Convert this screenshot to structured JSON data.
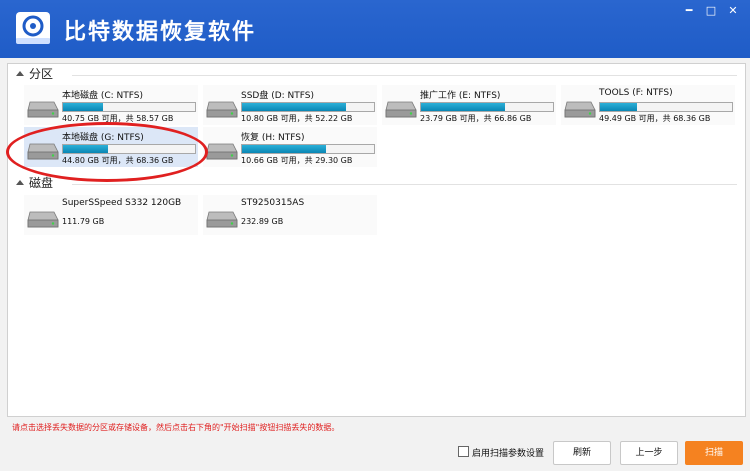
{
  "app": {
    "title": "比特数据恢复软件"
  },
  "window_controls": {
    "min": "━",
    "max": "□",
    "close": "✕"
  },
  "sections": {
    "partitions": "分区",
    "disks": "磁盘"
  },
  "partitions": [
    {
      "name": "本地磁盘 (C: NTFS)",
      "info": "40.75 GB 可用，共 58.57 GB",
      "used_fraction": 0.3
    },
    {
      "name": "SSD盘 (D: NTFS)",
      "info": "10.80 GB 可用，共 52.22 GB",
      "used_fraction": 0.79
    },
    {
      "name": "推广工作 (E: NTFS)",
      "info": "23.79 GB 可用，共 66.86 GB",
      "used_fraction": 0.64
    },
    {
      "name": "TOOLS (F: NTFS)",
      "info": "49.49 GB 可用，共 68.36 GB",
      "used_fraction": 0.28
    },
    {
      "name": "本地磁盘 (G: NTFS)",
      "info": "44.80 GB 可用，共 68.36 GB",
      "used_fraction": 0.34,
      "selected": true
    },
    {
      "name": "恢复 (H: NTFS)",
      "info": "10.66 GB 可用，共 29.30 GB",
      "used_fraction": 0.64
    }
  ],
  "disks": [
    {
      "name": "SuperSSpeed S332 120GB",
      "info": "111.79 GB"
    },
    {
      "name": "ST9250315AS",
      "info": "232.89 GB"
    }
  ],
  "footer": {
    "hint": "请点击选择丢失数据的分区或存储设备，然后点击右下角的\"开始扫描\"按钮扫描丢失的数据。",
    "advanced_checkbox": "启用扫描参数设置",
    "refresh": "刷新",
    "back": "上一步",
    "scan": "扫描"
  },
  "colors": {
    "titlebar": "#1f5cc7",
    "accent": "#f58220",
    "bar": "#0a86b4",
    "hint": "#e02020"
  },
  "icons": {
    "logo": "app-logo-icon",
    "drive": "hard-drive-icon"
  }
}
